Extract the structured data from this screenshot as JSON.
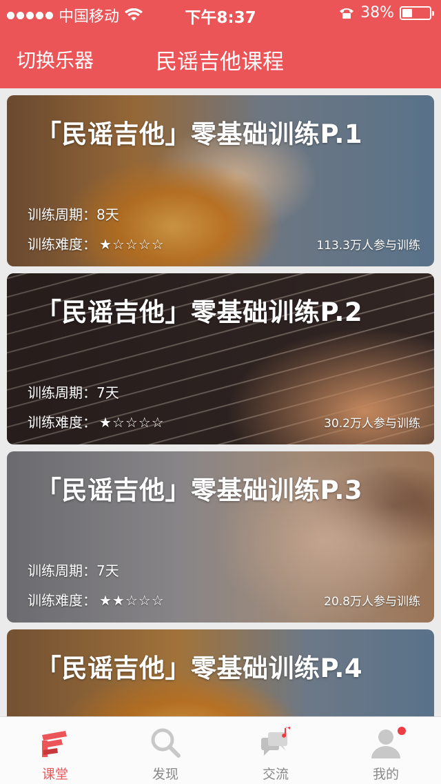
{
  "status_bar": {
    "carrier": "中国移动",
    "time": "下午8:37",
    "battery": "38%",
    "battery_level": 0.38
  },
  "header": {
    "left_action": "切换乐器",
    "title": "民谣吉他课程"
  },
  "courses": [
    {
      "title": "「民谣吉他」零基础训练P.1",
      "period_label": "训练周期：",
      "period_value": "8天",
      "difficulty_label": "训练难度：",
      "difficulty_stars": "★☆☆☆☆",
      "participants": "113.3万人参与训练"
    },
    {
      "title": "「民谣吉他」零基础训练P.2",
      "period_label": "训练周期：",
      "period_value": "7天",
      "difficulty_label": "训练难度：",
      "difficulty_stars": "★☆☆☆☆",
      "participants": "30.2万人参与训练"
    },
    {
      "title": "「民谣吉他」零基础训练P.3",
      "period_label": "训练周期：",
      "period_value": "7天",
      "difficulty_label": "训练难度：",
      "difficulty_stars": "★★☆☆☆",
      "participants": "20.8万人参与训练"
    },
    {
      "title": "「民谣吉他」零基础训练P.4"
    }
  ],
  "tabs": [
    {
      "label": "课堂",
      "icon": "classroom-icon",
      "active": true
    },
    {
      "label": "发现",
      "icon": "search-icon",
      "active": false
    },
    {
      "label": "交流",
      "icon": "chat-icon",
      "active": false
    },
    {
      "label": "我的",
      "icon": "profile-icon",
      "active": false
    }
  ],
  "colors": {
    "accent": "#ec5558",
    "tab_inactive": "#888888",
    "badge": "#ec3d45"
  }
}
